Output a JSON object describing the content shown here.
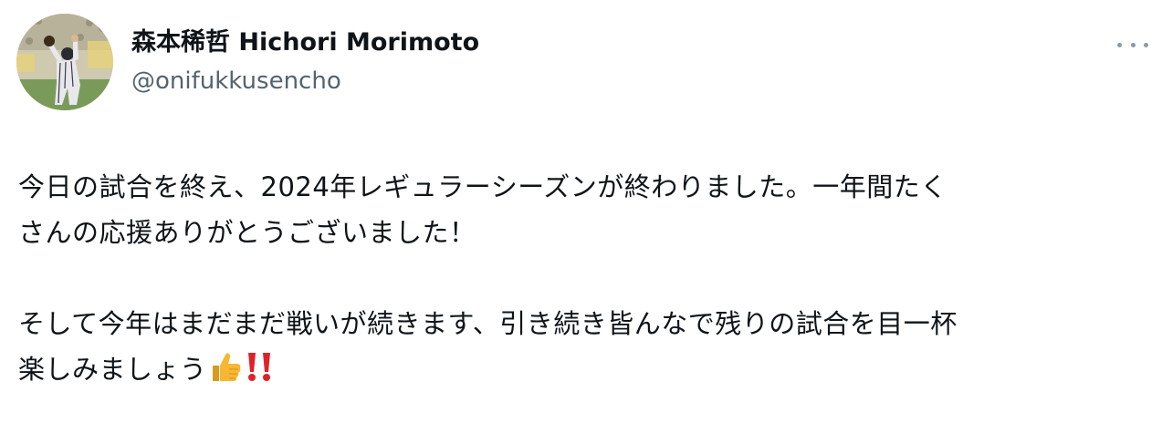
{
  "user": {
    "display_name": "森本稀哲 Hichori Morimoto",
    "handle": "@onifukkusencho",
    "avatar_icon": "baseball-player-avatar"
  },
  "menu": {
    "icon": "more-options-icon"
  },
  "post": {
    "paragraph1": {
      "line1": "今日の試合を終え、2024年レギュラーシーズンが終わりました。一年間たく",
      "line2": "さんの応援ありがとうございました！"
    },
    "paragraph2": {
      "line1": "そして今年はまだまだ戦いが続きます、引き続き皆んなで残りの試合を目一杯",
      "line2": "楽しみましょう"
    },
    "emojis": [
      "thumbs-up-icon",
      "double-exclamation-icon"
    ]
  },
  "colors": {
    "text_primary": "#0f1419",
    "text_secondary": "#536471",
    "emoji_red": "#e0212a",
    "emoji_thumb": "#f7b733"
  }
}
